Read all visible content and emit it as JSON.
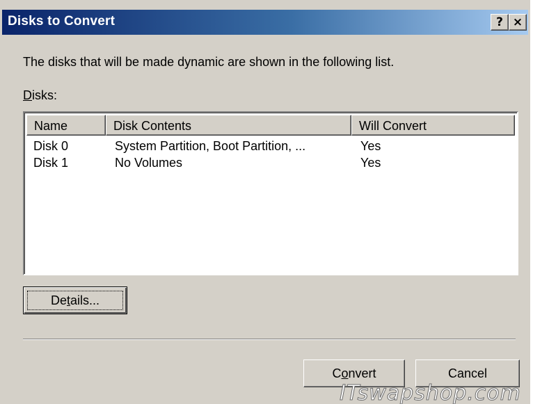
{
  "window": {
    "title": "Disks to Convert",
    "help_label": "?",
    "close_label": "×"
  },
  "intro_text": "The disks that will be made dynamic are shown in the following list.",
  "disks_label": {
    "accel": "D",
    "rest": "isks:"
  },
  "list": {
    "columns": [
      "Name",
      "Disk Contents",
      "Will Convert"
    ],
    "rows": [
      {
        "name": "Disk 0",
        "contents": "System Partition, Boot Partition, ...",
        "convert": "Yes"
      },
      {
        "name": "Disk 1",
        "contents": "No Volumes",
        "convert": "Yes"
      }
    ]
  },
  "buttons": {
    "details": {
      "pre": "De",
      "accel": "t",
      "post": "ails..."
    },
    "convert": {
      "pre": "C",
      "accel": "o",
      "post": "nvert"
    },
    "cancel": "Cancel"
  },
  "watermark": "ITswapshop.com",
  "colors": {
    "title_start": "#0a246a",
    "title_end": "#a6caf0",
    "face": "#d4d0c8"
  }
}
